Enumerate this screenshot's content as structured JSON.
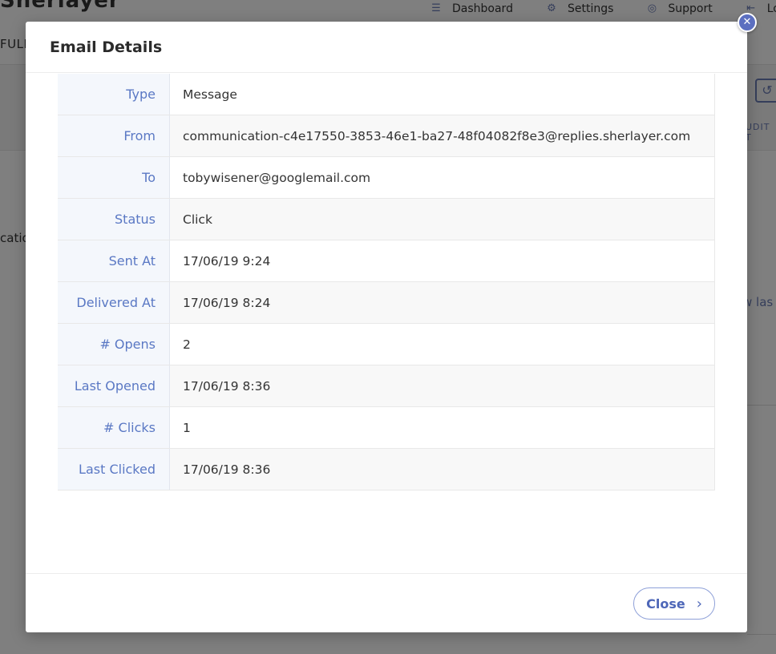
{
  "background": {
    "logo_fragment": "Sherlayer",
    "nav": [
      {
        "label": "Dashboard",
        "icon": "list-icon"
      },
      {
        "label": "Settings",
        "icon": "gear-icon"
      },
      {
        "label": "Support",
        "icon": "support-icon"
      },
      {
        "label": "Lo",
        "icon": "logout-icon"
      }
    ],
    "full_fragment": "FULL",
    "audit_fragment": "UDIT T",
    "cation_fragment": "catio",
    "viewlast_fragment": "w las"
  },
  "modal": {
    "title": "Email Details",
    "close_x_glyph": "✕",
    "rows": [
      {
        "label": "Type",
        "value": "Message"
      },
      {
        "label": "From",
        "value": "communication-c4e17550-3853-46e1-ba27-48f04082f8e3@replies.sherlayer.com"
      },
      {
        "label": "To",
        "value": "tobywisener@googlemail.com"
      },
      {
        "label": "Status",
        "value": "Click"
      },
      {
        "label": "Sent At",
        "value": "17/06/19 9:24"
      },
      {
        "label": "Delivered At",
        "value": "17/06/19 8:24"
      },
      {
        "label": "# Opens",
        "value": "2"
      },
      {
        "label": "Last Opened",
        "value": "17/06/19 8:36"
      },
      {
        "label": "# Clicks",
        "value": "1"
      },
      {
        "label": "Last Clicked",
        "value": "17/06/19 8:36"
      }
    ],
    "footer": {
      "close_label": "Close",
      "close_chevron": "›"
    }
  },
  "colors": {
    "accent": "#5a78c4",
    "overlay": "rgba(0,0,0,0.5)"
  }
}
